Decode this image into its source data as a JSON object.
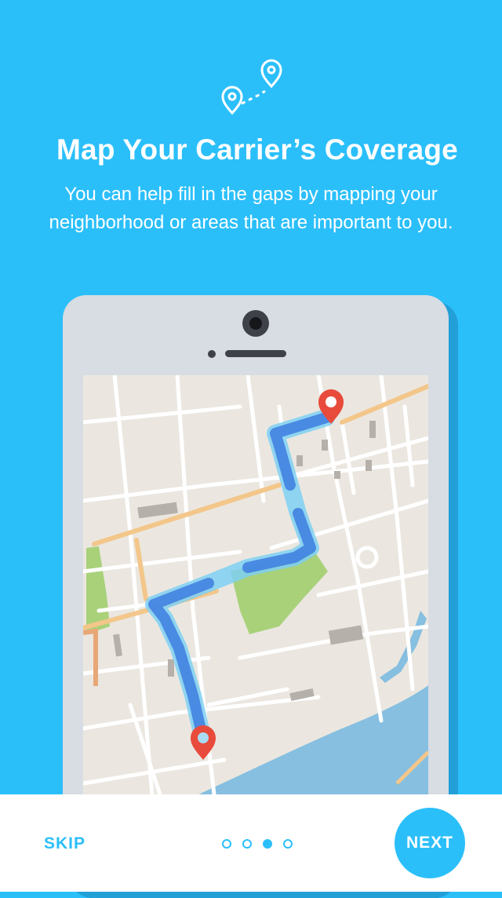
{
  "header": {
    "icon": "map-pins-route-icon",
    "title": "Map Your Carrier’s Coverage",
    "subtitle": "You can help fill in the gaps by mapping your neighborhood or areas that are important to you."
  },
  "illustration": {
    "device": "phone-icon",
    "map": "city-map",
    "pins": [
      "map-pin-icon",
      "map-pin-icon"
    ],
    "colors": {
      "route": "#3d7de0",
      "route_light": "#7fd0f2",
      "pin": "#e84b3c",
      "park": "#a9d17a",
      "water": "#86bfe0",
      "road_major": "#f3c68a"
    }
  },
  "footer": {
    "skip_label": "SKIP",
    "next_label": "NEXT",
    "page_count": 4,
    "active_page": 3
  },
  "colors": {
    "background": "#2bbffa",
    "text": "#ffffff",
    "footer": "#ffffff"
  }
}
